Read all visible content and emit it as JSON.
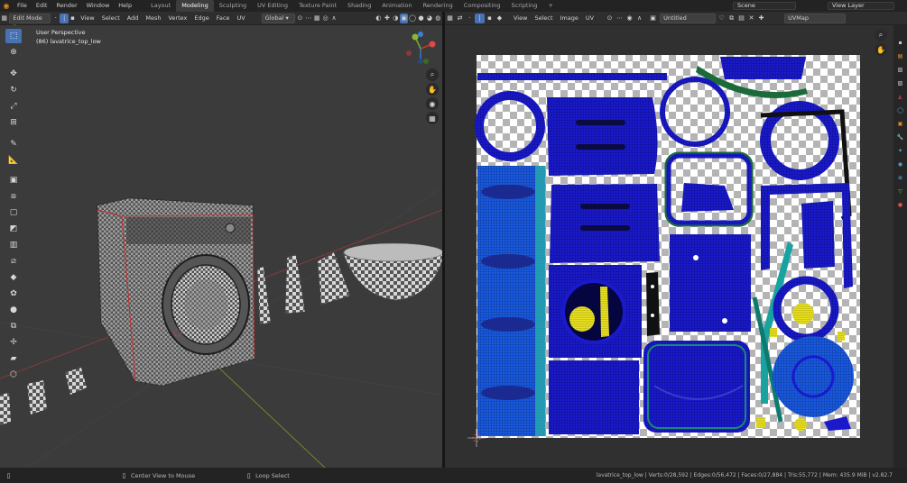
{
  "topbar": {
    "menus": [
      "File",
      "Edit",
      "Render",
      "Window",
      "Help"
    ],
    "workspaces": [
      "Layout",
      "Modeling",
      "Sculpting",
      "UV Editing",
      "Texture Paint",
      "Shading",
      "Animation",
      "Rendering",
      "Compositing",
      "Scripting"
    ],
    "active_workspace": "Modeling",
    "add_tab": "+",
    "scene": "Scene",
    "view_layer": "View Layer"
  },
  "view3d_header": {
    "mode": "Edit Mode",
    "menus": [
      "View",
      "Select",
      "Add",
      "Mesh",
      "Vertex",
      "Edge",
      "Face",
      "UV"
    ],
    "orientation": "Global"
  },
  "uv_header": {
    "menus": [
      "View",
      "Select",
      "Image",
      "UV"
    ],
    "image_name": "Untitled",
    "uvmap": "UVMap"
  },
  "viewport": {
    "perspective": "User Perspective",
    "object": "(86) lavatrice_top_low"
  },
  "statusbar": {
    "left_action": "Center View to Mouse",
    "mid_action": "Loop Select",
    "stats": "lavatrice_top_low | Verts:0/28,592 | Edges:0/56,472 | Faces:0/27,884 | Tris:55,772 | Mem: 435.9 MiB | v2.82.7"
  },
  "colors": {
    "accent": "#4772b3",
    "orange": "#e88a2d",
    "uv_blue": "#1a1acc",
    "uv_yellow": "#e8e020"
  }
}
